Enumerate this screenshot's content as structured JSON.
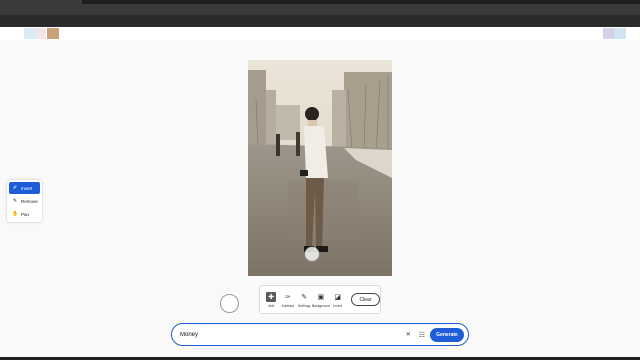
{
  "left_tools": {
    "items": [
      {
        "label": "Insert",
        "icon": "insert-icon",
        "active": true
      },
      {
        "label": "Remove",
        "icon": "eraser-icon",
        "active": false
      },
      {
        "label": "Pan",
        "icon": "hand-icon",
        "active": false
      }
    ]
  },
  "brush_bar": {
    "tools": [
      {
        "label": "Add",
        "icon": "add-brush-icon",
        "active": true
      },
      {
        "label": "Subtract",
        "icon": "subtract-brush-icon",
        "active": false
      },
      {
        "label": "Settings",
        "icon": "brush-settings-icon",
        "active": false
      },
      {
        "label": "Background",
        "icon": "background-icon",
        "active": false
      },
      {
        "label": "Invert",
        "icon": "invert-icon",
        "active": false
      }
    ],
    "clear_label": "Clear"
  },
  "prompt": {
    "value": "Money",
    "generate_label": "Generate"
  },
  "colors": {
    "accent": "#1d5ed8"
  }
}
